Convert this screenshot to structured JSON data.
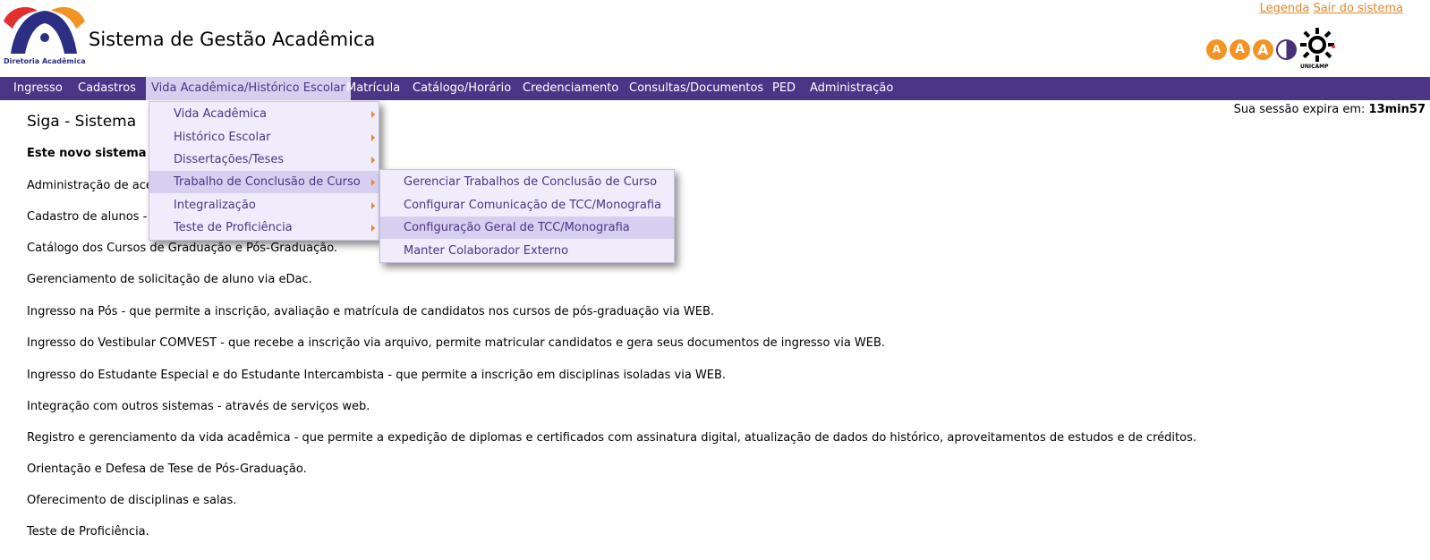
{
  "header": {
    "logo_text": "Diretoria Acadêmica",
    "title": "Sistema de Gestão Acadêmica",
    "links": [
      "Legenda",
      "Sair do sistema"
    ],
    "font_buttons": [
      "A",
      "A",
      "A"
    ],
    "university": "UNICAMP"
  },
  "menu": {
    "items": [
      "Ingresso",
      "Cadastros",
      "Vida Acadêmica/Histórico Escolar",
      "Matrícula",
      "Catálogo/Horário",
      "Credenciamento",
      "Consultas/Documentos",
      "PED",
      "Administração"
    ],
    "active_index": 2
  },
  "submenu": {
    "items": [
      "Vida Acadêmica",
      "Histórico Escolar",
      "Dissertações/Teses",
      "Trabalho de Conclusão de Curso",
      "Integralização",
      "Teste de Proficiência"
    ],
    "highlight_index": 3
  },
  "subsubmenu": {
    "items": [
      "Gerenciar Trabalhos de Conclusão de Curso",
      "Configurar Comunicação de TCC/Monografia",
      "Configuração Geral de TCC/Monografia",
      "Manter Colaborador Externo"
    ],
    "highlight_index": 2
  },
  "session": {
    "label": "Sua sessão expira em:",
    "time": "13min57"
  },
  "content": {
    "heading": "Siga - Sistema",
    "intro": "Este novo sistema co",
    "paragraphs": [
      "Administração de aces",
      "Cadastro de alunos -",
      "Catálogo dos Cursos de Graduação e Pós-Graduação.",
      "Gerenciamento de solicitação de aluno via eDac.",
      "Ingresso na Pós - que permite a inscrição, avaliação e matrícula de candidatos nos cursos de pós-graduação via WEB.",
      "Ingresso do Vestibular COMVEST - que recebe a inscrição via arquivo, permite matricular candidatos e gera seus documentos de ingresso via WEB.",
      "Ingresso do Estudante Especial e do Estudante Intercambista - que permite a inscrição em disciplinas isoladas via WEB.",
      "Integração com outros sistemas - através de serviços web.",
      "Registro e gerenciamento da vida acadêmica - que permite a expedição de diplomas e certificados com assinatura digital, atualização de dados do histórico, aproveitamentos de estudos e de créditos.",
      "Orientação e Defesa de Tese de Pós-Graduação.",
      "Oferecimento de disciplinas e salas.",
      "Teste de Proficiência."
    ]
  },
  "colors": {
    "menubar": "#4b3586",
    "menu_active": "#d7cff0",
    "link": "#e8862b",
    "font_button": "#f39324"
  }
}
